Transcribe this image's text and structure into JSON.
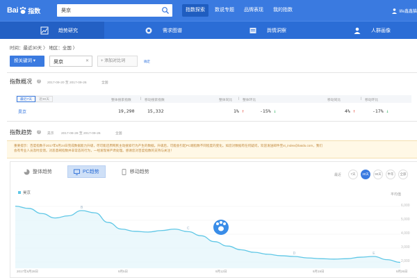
{
  "topbar": {
    "logo_text": "Bai",
    "logo_suffix": "指数",
    "search_value": "昊京",
    "nav": [
      "指数探索",
      "数说专题",
      "品牌表现",
      "我的指数"
    ],
    "user": "life鑫鑫猫"
  },
  "subnav": {
    "items": [
      {
        "label": "趋势研究",
        "icon": "trend-icon"
      },
      {
        "label": "需求图谱",
        "icon": "graph-icon"
      },
      {
        "label": "舆情洞察",
        "icon": "newspaper-icon"
      },
      {
        "label": "人群画像",
        "icon": "people-icon"
      }
    ]
  },
  "filter": {
    "line": "时间：最近30天 〉 地区：全国 〉",
    "keyword_button": "按关键词 ▾",
    "keyword": "昊京",
    "add_compare": "+ 添加对比词",
    "confirm": "确定"
  },
  "overview": {
    "title": "指数概况",
    "date_range": "2017-09-20 至 2017-09-26",
    "region": "全国",
    "tabs": [
      "最近7天",
      "近30天"
    ],
    "headers": [
      "整体搜索指数",
      "移动搜索指数",
      "整体同比",
      "整体环比",
      "移动同比",
      "移动环比"
    ],
    "keyword": "昊京",
    "total_index": "19,290",
    "mobile_index": "15,332",
    "total_yoy": "1%",
    "total_mom": "-15%",
    "mobile_yoy": "4%",
    "mobile_mom": "-17%"
  },
  "trend": {
    "title": "指数趋势",
    "keyword": "昊京",
    "date_range": "2017-08-28 至 2017-09-26",
    "region": "全国",
    "notice_line1": "重要提示：百度指数于2017年6月24日完成数据能力升级，尽可能还原网民主动搜索行为产生的数据。升级后，可能会引起PC端指数不同程度的变化。如您对数据有任何疑问，欢迎发送邮件至xt_index@baidu.com，我们",
    "notice_line2": "会有专业人员及时反馈。对恶意刷指数并非常态的行为，一经发现将严肃处理。感谢您对百度指数的支持与关注！",
    "view_tabs": [
      "整体趋势",
      "PC趋势",
      "移动趋势"
    ],
    "range_label": "最近",
    "ranges": [
      "7天",
      "30天",
      "90天",
      "半年",
      "全部"
    ],
    "legend": "昊京",
    "avg_label": "平均值",
    "y_ticks": [
      "6,000",
      "5,000",
      "4,000",
      "3,000",
      "2,000"
    ],
    "x_ticks": [
      "2017年8月28日",
      "9月5日",
      "9月12日",
      "9月19日",
      "9月26日"
    ],
    "peak_labels": [
      "B",
      "C",
      "D",
      "E"
    ]
  },
  "chart_data": {
    "type": "line",
    "title": "",
    "xlabel": "",
    "ylabel": "",
    "x": [
      "2017-08-28",
      "2017-08-29",
      "2017-08-30",
      "2017-08-31",
      "2017-09-01",
      "2017-09-02",
      "2017-09-03",
      "2017-09-04",
      "2017-09-05",
      "2017-09-06",
      "2017-09-07",
      "2017-09-08",
      "2017-09-09",
      "2017-09-10",
      "2017-09-11",
      "2017-09-12",
      "2017-09-13",
      "2017-09-14",
      "2017-09-15",
      "2017-09-16",
      "2017-09-17",
      "2017-09-18",
      "2017-09-19",
      "2017-09-20",
      "2017-09-21",
      "2017-09-22",
      "2017-09-23",
      "2017-09-24",
      "2017-09-25",
      "2017-09-26"
    ],
    "series": [
      {
        "name": "昊京",
        "values": [
          6000,
          5850,
          5500,
          5200,
          5350,
          5700,
          5550,
          4900,
          4450,
          4300,
          4250,
          4350,
          4450,
          4280,
          4000,
          3600,
          3300,
          3050,
          2880,
          2750,
          2650,
          2600,
          2500,
          2450,
          2420,
          2450,
          2550,
          2600,
          2380,
          2200
        ]
      }
    ],
    "ylim": [
      1800,
      6500
    ],
    "color": "#5fc7e6"
  }
}
